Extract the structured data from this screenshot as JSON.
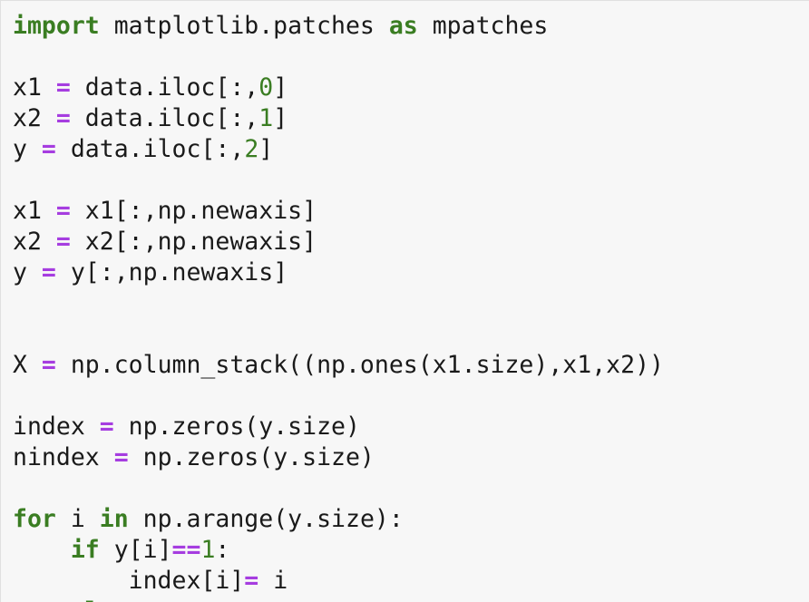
{
  "colors": {
    "background": "#f7f7f7",
    "text": "#1a1a1a",
    "keyword": "#3a7d22",
    "operator": "#a63de0",
    "number": "#3a7d22"
  },
  "code_lines": [
    [
      [
        "kw",
        "import"
      ],
      [
        "tx",
        " matplotlib.patches "
      ],
      [
        "kw",
        "as"
      ],
      [
        "tx",
        " mpatches"
      ]
    ],
    [],
    [
      [
        "tx",
        "x1 "
      ],
      [
        "op",
        "="
      ],
      [
        "tx",
        " data.iloc[:,"
      ],
      [
        "num",
        "0"
      ],
      [
        "tx",
        "]"
      ]
    ],
    [
      [
        "tx",
        "x2 "
      ],
      [
        "op",
        "="
      ],
      [
        "tx",
        " data.iloc[:,"
      ],
      [
        "num",
        "1"
      ],
      [
        "tx",
        "]"
      ]
    ],
    [
      [
        "tx",
        "y "
      ],
      [
        "op",
        "="
      ],
      [
        "tx",
        " data.iloc[:,"
      ],
      [
        "num",
        "2"
      ],
      [
        "tx",
        "]"
      ]
    ],
    [],
    [
      [
        "tx",
        "x1 "
      ],
      [
        "op",
        "="
      ],
      [
        "tx",
        " x1[:,np.newaxis]"
      ]
    ],
    [
      [
        "tx",
        "x2 "
      ],
      [
        "op",
        "="
      ],
      [
        "tx",
        " x2[:,np.newaxis]"
      ]
    ],
    [
      [
        "tx",
        "y "
      ],
      [
        "op",
        "="
      ],
      [
        "tx",
        " y[:,np.newaxis]"
      ]
    ],
    [],
    [],
    [
      [
        "tx",
        "X "
      ],
      [
        "op",
        "="
      ],
      [
        "tx",
        " np.column_stack((np.ones(x1.size),x1,x2))"
      ]
    ],
    [],
    [
      [
        "tx",
        "index "
      ],
      [
        "op",
        "="
      ],
      [
        "tx",
        " np.zeros(y.size)"
      ]
    ],
    [
      [
        "tx",
        "nindex "
      ],
      [
        "op",
        "="
      ],
      [
        "tx",
        " np.zeros(y.size)"
      ]
    ],
    [],
    [
      [
        "kw",
        "for"
      ],
      [
        "tx",
        " i "
      ],
      [
        "kw",
        "in"
      ],
      [
        "tx",
        " np.arange(y.size):"
      ]
    ],
    [
      [
        "tx",
        "    "
      ],
      [
        "kw",
        "if"
      ],
      [
        "tx",
        " y[i]"
      ],
      [
        "op",
        "=="
      ],
      [
        "num",
        "1"
      ],
      [
        "tx",
        ":"
      ]
    ],
    [
      [
        "tx",
        "        index[i]"
      ],
      [
        "op",
        "="
      ],
      [
        "tx",
        " i"
      ]
    ],
    [
      [
        "tx",
        "    "
      ],
      [
        "kw",
        "el"
      ]
    ]
  ]
}
